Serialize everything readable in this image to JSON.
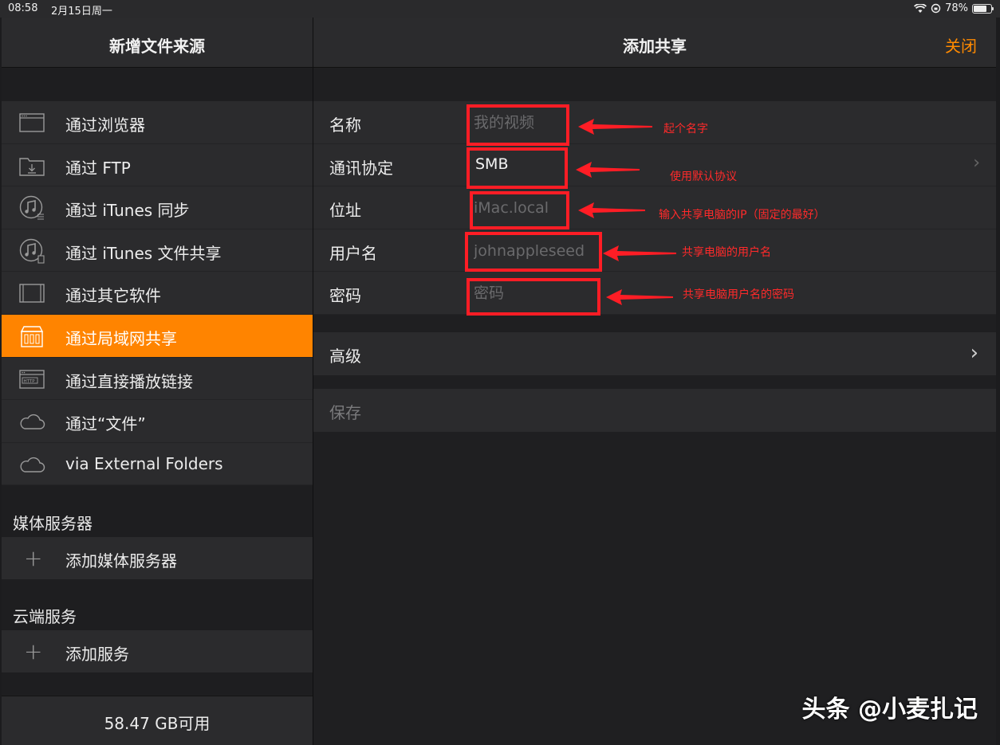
{
  "status": {
    "time": "08:58",
    "date": "2月15日周一",
    "battery": "78%",
    "battery_level": 0.78
  },
  "left": {
    "title": "新增文件来源",
    "sources": [
      {
        "label": "通过浏览器",
        "icon": "browser-window-icon",
        "active": false
      },
      {
        "label": "通过 FTP",
        "icon": "folder-download-icon",
        "active": false
      },
      {
        "label": "通过 iTunes 同步",
        "icon": "itunes-sync-icon",
        "active": false
      },
      {
        "label": "通过 iTunes 文件共享",
        "icon": "itunes-file-share-icon",
        "active": false
      },
      {
        "label": "通过其它软件",
        "icon": "app-window-icon",
        "active": false
      },
      {
        "label": "通过局域网共享",
        "icon": "nas-server-icon",
        "active": true
      },
      {
        "label": "通过直接播放链接",
        "icon": "http-link-icon",
        "active": false
      },
      {
        "label": "通过“文件”",
        "icon": "cloud-icon",
        "active": false
      },
      {
        "label": "via External Folders",
        "icon": "cloud-icon",
        "active": false
      }
    ],
    "media_section": "媒体服务器",
    "add_media": "添加媒体服务器",
    "cloud_section": "云端服务",
    "add_service": "添加服务",
    "storage": "58.47 GB可用"
  },
  "right": {
    "title": "添加共享",
    "close": "关闭",
    "fields": {
      "name_label": "名称",
      "name_placeholder": "我的视频",
      "protocol_label": "通讯协定",
      "protocol_value": "SMB",
      "address_label": "位址",
      "address_placeholder": "iMac.local",
      "username_label": "用户名",
      "username_placeholder": "johnappleseed",
      "password_label": "密码",
      "password_placeholder": "密码"
    },
    "advanced": "高级",
    "save": "保存"
  },
  "annotations": {
    "name": "起个名字",
    "protocol": "使用默认协议",
    "address": "输入共享电脑的IP（固定的最好）",
    "username": "共享电脑的用户名",
    "password": "共享电脑用户名的密码",
    "color": "#ff1d25"
  },
  "watermark": "头条 @小麦扎记",
  "colors": {
    "accent": "#ff8400",
    "background": "#1e1e20",
    "row": "#2b2b2d"
  }
}
